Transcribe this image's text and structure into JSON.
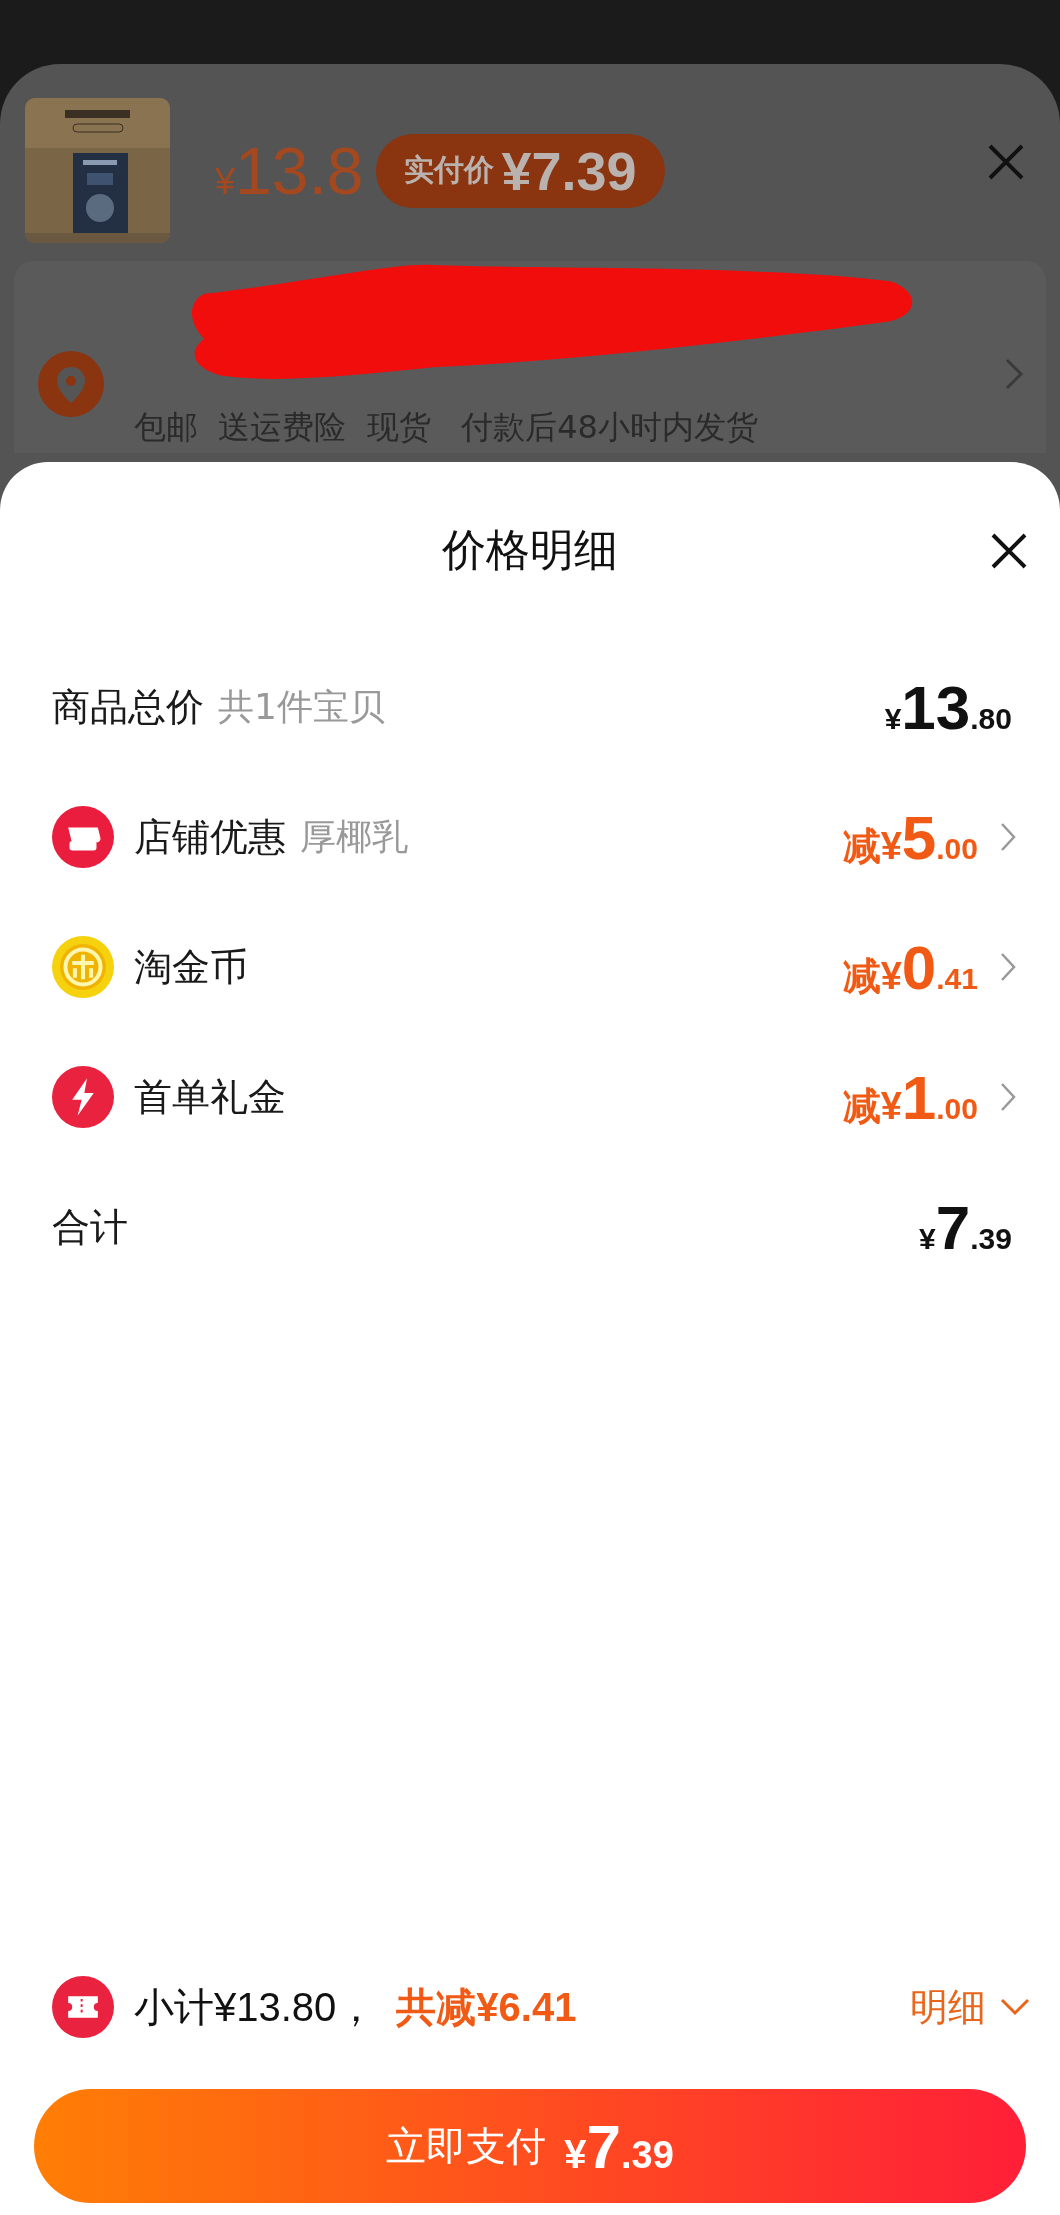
{
  "background": {
    "price": "¥13.8",
    "badge": {
      "label": "实付价",
      "price": "¥7.39"
    },
    "shipping": "包邮  送运费险  现货   付款后48小时内发货"
  },
  "sheet": {
    "title": "价格明细",
    "rows": [
      {
        "kind": "total",
        "label": "商品总价",
        "note": "共1件宝贝",
        "amount": "¥13.80"
      },
      {
        "kind": "discount",
        "label": "店铺优惠",
        "note": "厚椰乳",
        "amount": "减¥5.00"
      },
      {
        "kind": "discount",
        "label": "淘金币",
        "amount": "减¥0.41"
      },
      {
        "kind": "discount",
        "label": "首单礼金",
        "amount": "减¥1.00"
      },
      {
        "kind": "total",
        "label": "合计",
        "amount": "¥7.39"
      }
    ],
    "summary": {
      "subtotal": "小计¥13.80，",
      "saving": "共减¥6.41",
      "details": "明细"
    },
    "pay_button": {
      "label": "立即支付",
      "amount": "¥7.39"
    }
  }
}
